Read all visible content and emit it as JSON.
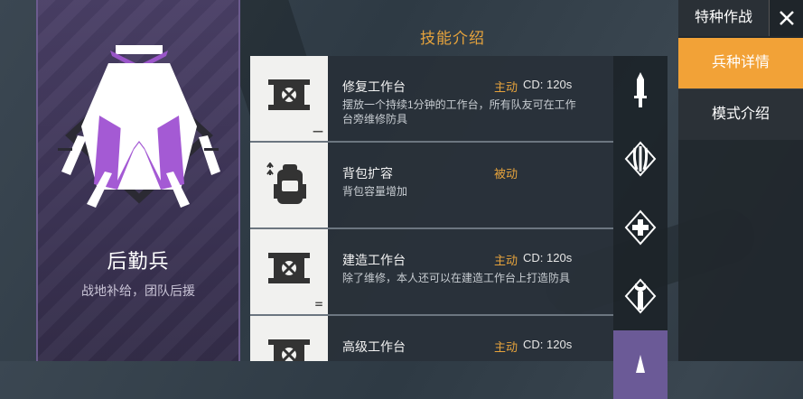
{
  "hero": {
    "name": "后勤兵",
    "description": "战地补给，团队后援",
    "emblem": "support-class-emblem"
  },
  "section_title": "技能介绍",
  "skills": [
    {
      "name": "修复工作台",
      "type": "主动",
      "cd": "CD: 120s",
      "description": "摆放一个持续1分钟的工作台，所有队友可在工作台旁维修防具",
      "icon": "repair-workbench-icon",
      "level": "—"
    },
    {
      "name": "背包扩容",
      "type": "被动",
      "cd": "",
      "description": "背包容量增加",
      "icon": "backpack-icon",
      "level": ""
    },
    {
      "name": "建造工作台",
      "type": "主动",
      "cd": "CD: 120s",
      "description": "除了维修，本人还可以在建造工作台上打造防具",
      "icon": "build-workbench-icon",
      "level": "="
    },
    {
      "name": "高级工作台",
      "type": "主动",
      "cd": "CD: 120s",
      "description": "",
      "icon": "advanced-workbench-icon",
      "level": ""
    }
  ],
  "rail_icons": [
    "dagger-icon",
    "claw-icon",
    "plus-icon",
    "wrench-icon",
    "support-class-icon"
  ],
  "mode": {
    "title": "特种作战",
    "close_icon": "close-icon"
  },
  "menu": [
    {
      "label": "兵种详情",
      "active": true
    },
    {
      "label": "模式介绍",
      "active": false
    }
  ],
  "colors": {
    "accent": "#f2a237",
    "class_purple": "#6b5a97",
    "skill_type": "#e6a33c"
  }
}
